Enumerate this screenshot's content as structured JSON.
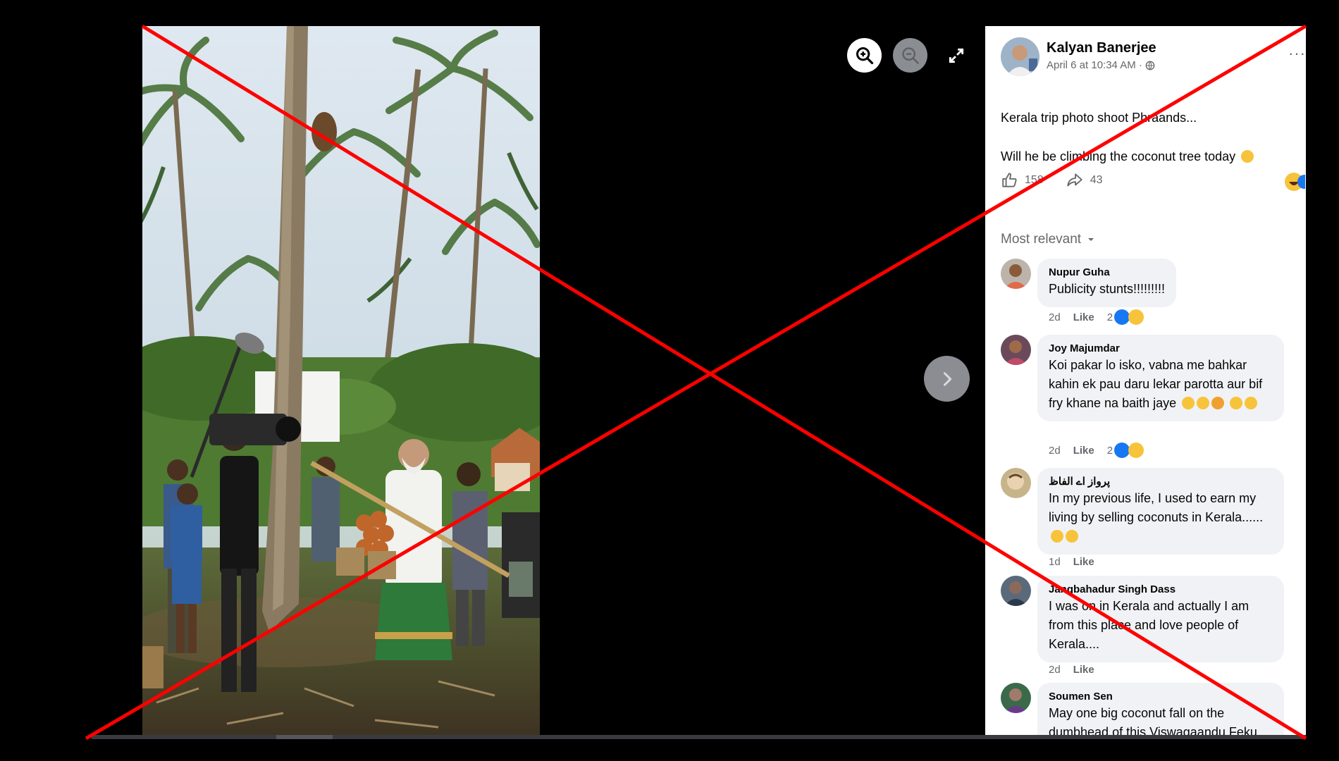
{
  "viewer": {
    "zoom_in_icon": "zoom-in-icon",
    "zoom_out_icon": "zoom-out-icon",
    "fullscreen_icon": "expand-icon",
    "next_icon": "chevron-right-icon"
  },
  "post": {
    "author": "Kalyan Banerjee",
    "timestamp": "April 6 at 10:34 AM · ",
    "privacy_icon": "globe-icon",
    "more_label": "···",
    "text_line1": "Kerala trip photo shoot Phraands...",
    "text_line2": "Will he be climbing the coconut tree today",
    "likes": "158",
    "shares": "43",
    "sort_label": "Most relevant"
  },
  "comments": [
    {
      "name": "Nupur Guha",
      "text": "Publicity stunts!!!!!!!!!",
      "time": "2d",
      "like": "Like",
      "reactions": "2"
    },
    {
      "name": "Joy Majumdar",
      "text": "Koi pakar lo isko, vabna me bahkar kahin ek pau daru lekar parotta aur bif fry khane na baith jaye",
      "time": "2d",
      "like": "Like",
      "reactions": "2"
    },
    {
      "name": "پرواز اے الفاظ",
      "text": "In my previous life, I used to earn my living by selling coconuts in Kerala......",
      "time": "1d",
      "like": "Like"
    },
    {
      "name": "Jangbahadur Singh Dass",
      "text": "I was on in Kerala and actually I am from this place and love people of Kerala....",
      "time": "2d",
      "like": "Like"
    },
    {
      "name": "Soumen Sen",
      "text": "May one big coconut fall on the dumbhead of this Viswagaandu Feku"
    }
  ],
  "colors": {
    "overlay_x": "#ff0000",
    "like_blue": "#1877f2",
    "bubble": "#f0f2f5",
    "meta_gray": "#65676b"
  }
}
